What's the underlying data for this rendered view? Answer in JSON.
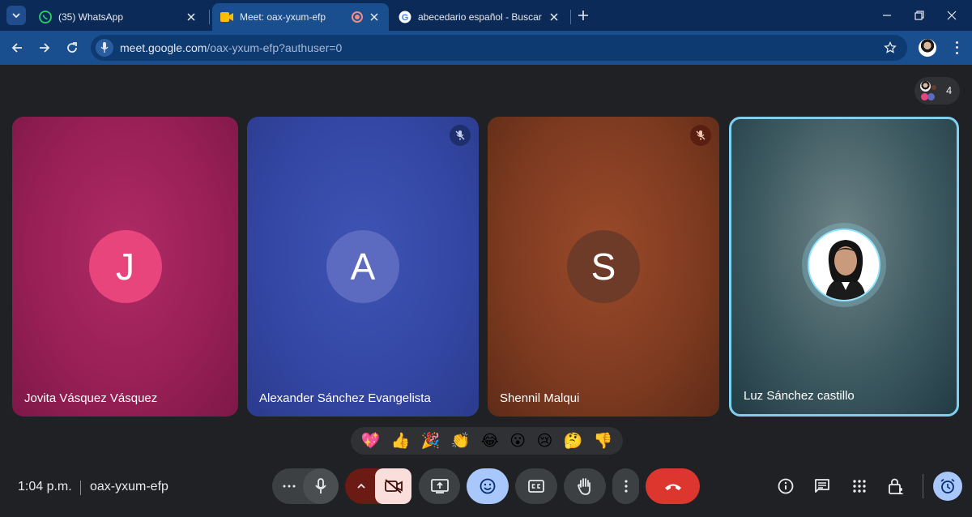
{
  "browser": {
    "tabs": [
      {
        "label": "(35) WhatsApp",
        "icon": "whatsapp-icon",
        "active": false
      },
      {
        "label": "Meet: oax-yxum-efp",
        "icon": "google-meet-icon",
        "active": true
      },
      {
        "label": "abecedario español - Buscar co",
        "icon": "google-icon",
        "active": false
      }
    ],
    "url_host": "meet.google.com",
    "url_path": "/oax-yxum-efp?authuser=0"
  },
  "meet": {
    "participant_count": "4",
    "participants": [
      {
        "initial": "J",
        "name": "Jovita Vásquez Vásquez",
        "avatar_color": "#e8457c",
        "muted": false
      },
      {
        "initial": "A",
        "name": "Alexander Sánchez Evangelista",
        "avatar_color": "#5c6bc0",
        "muted": true
      },
      {
        "initial": "S",
        "name": "Shennil Malqui",
        "avatar_color": "#6d3b28",
        "muted": true
      },
      {
        "initial": "",
        "name": "Luz Sánchez castillo",
        "avatar_color": "#ffffff",
        "muted": false,
        "speaking": true
      }
    ],
    "reactions": [
      "💖",
      "👍",
      "🎉",
      "👏",
      "😂",
      "😮",
      "😢",
      "🤔",
      "👎"
    ],
    "time": "1:04 p.m.",
    "meeting_code": "oax-yxum-efp"
  },
  "colors": {
    "end_call": "#dc362e",
    "camera_off_bg": "#f9dedc",
    "active_control": "#a8c7fa",
    "speaking_border": "#7fd0f0"
  }
}
